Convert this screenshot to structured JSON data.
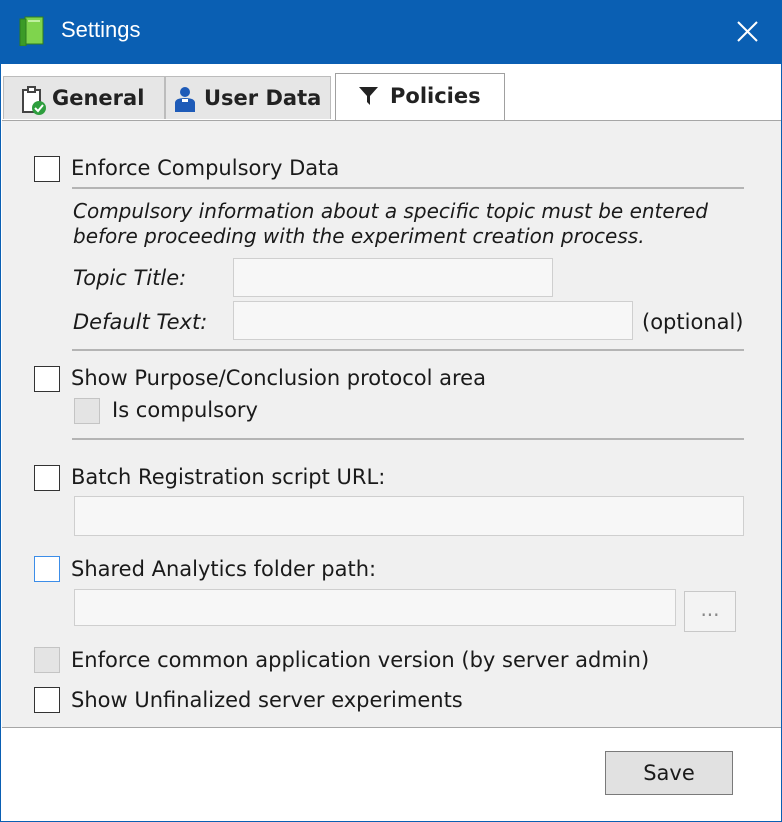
{
  "window": {
    "title": "Settings",
    "icon": "book-icon",
    "accent": "#0a5fb3"
  },
  "tabs": [
    {
      "label": "General",
      "icon": "clipboard-check-icon"
    },
    {
      "label": "User Data",
      "icon": "user-icon"
    },
    {
      "label": "Policies",
      "icon": "filter-icon",
      "active": true
    }
  ],
  "policies": {
    "enforce_compulsory": {
      "label": "Enforce Compulsory Data",
      "checked": false,
      "description_line1": "Compulsory information about a specific topic must be entered",
      "description_line2": "before proceeding with the experiment creation process.",
      "topic_title_label": "Topic Title:",
      "topic_title_value": "",
      "default_text_label": "Default Text:",
      "default_text_value": "",
      "optional_label": "(optional)"
    },
    "purpose_conclusion": {
      "label": "Show Purpose/Conclusion protocol area",
      "checked": false,
      "is_compulsory_label": "Is compulsory",
      "is_compulsory_checked": false
    },
    "batch_registration": {
      "label": "Batch Registration script URL:",
      "checked": false,
      "url_value": ""
    },
    "shared_analytics": {
      "label": "Shared Analytics folder path:",
      "checked": false,
      "path_value": "",
      "browse_label": "..."
    },
    "enforce_version": {
      "label": "Enforce common application version (by server admin)",
      "checked": false
    },
    "show_unfinalized": {
      "label": "Show Unfinalized server experiments",
      "checked": false
    }
  },
  "footer": {
    "save_label": "Save"
  }
}
